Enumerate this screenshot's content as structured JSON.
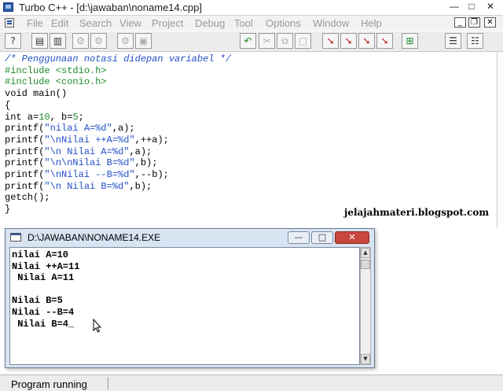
{
  "window": {
    "title": "Turbo C++ - [d:\\jawaban\\noname14.cpp]",
    "icon": "turbo-cpp-app-icon",
    "controls": {
      "minimize": "—",
      "maximize": "□",
      "close": "✕"
    }
  },
  "menu": {
    "items": [
      "File",
      "Edit",
      "Search",
      "View",
      "Project",
      "Debug",
      "Tool",
      "Options",
      "Window",
      "Help"
    ],
    "mdi_controls": {
      "minimize": "_",
      "restore": "❐",
      "close": "✕"
    },
    "item_color": "#9a9a9a"
  },
  "toolbar": {
    "buttons": [
      {
        "icon": "help-context-icon",
        "glyph": "?"
      },
      {
        "icon": "open-file-icon",
        "glyph": "▤"
      },
      {
        "icon": "save-file-icon",
        "glyph": "▥"
      },
      {
        "icon": "compile-icon",
        "glyph": "⚙"
      },
      {
        "icon": "make-icon",
        "glyph": "⚙"
      },
      {
        "icon": "build-icon",
        "glyph": "⚙"
      },
      {
        "icon": "run-icon",
        "glyph": "▣"
      },
      {
        "icon": "undo-icon",
        "glyph": "↶"
      },
      {
        "icon": "cut-icon",
        "glyph": "✂"
      },
      {
        "icon": "copy-icon",
        "glyph": "⧉"
      },
      {
        "icon": "paste-icon",
        "glyph": "▢"
      },
      {
        "icon": "search-icon",
        "glyph": "➘"
      },
      {
        "icon": "replace-icon",
        "glyph": "➘"
      },
      {
        "icon": "search-again-icon",
        "glyph": "➘"
      },
      {
        "icon": "find-in-files-icon",
        "glyph": "➘"
      },
      {
        "icon": "browse-icon",
        "glyph": "⊞"
      },
      {
        "icon": "project-icon",
        "glyph": "☰"
      },
      {
        "icon": "message-icon",
        "glyph": "☷"
      }
    ]
  },
  "editor": {
    "filename": "noname14.cpp",
    "lines": [
      [
        {
          "t": "/* Penggunaan notasi didepan variabel */",
          "c": "c-comment"
        }
      ],
      [
        {
          "t": "#include <stdio.h>",
          "c": "c-pp"
        }
      ],
      [
        {
          "t": "#include <conio.h>",
          "c": "c-pp"
        }
      ],
      [
        {
          "t": "void main()",
          "c": ""
        }
      ],
      [
        {
          "t": "{",
          "c": ""
        }
      ],
      [
        {
          "t": "int a=",
          "c": ""
        },
        {
          "t": "10",
          "c": "c-num"
        },
        {
          "t": ", b=",
          "c": ""
        },
        {
          "t": "5",
          "c": "c-num"
        },
        {
          "t": ";",
          "c": ""
        }
      ],
      [
        {
          "t": "printf(",
          "c": ""
        },
        {
          "t": "\"nilai A=%d\"",
          "c": "c-str"
        },
        {
          "t": ",a);",
          "c": ""
        }
      ],
      [
        {
          "t": "printf(",
          "c": ""
        },
        {
          "t": "\"\\nNilai ++A=%d\"",
          "c": "c-str"
        },
        {
          "t": ",++a);",
          "c": ""
        }
      ],
      [
        {
          "t": "printf(",
          "c": ""
        },
        {
          "t": "\"\\n Nilai A=%d\"",
          "c": "c-str"
        },
        {
          "t": ",a);",
          "c": ""
        }
      ],
      [
        {
          "t": "printf(",
          "c": ""
        },
        {
          "t": "\"\\n\\nNilai B=%d\"",
          "c": "c-str"
        },
        {
          "t": ",b);",
          "c": ""
        }
      ],
      [
        {
          "t": "printf(",
          "c": ""
        },
        {
          "t": "\"\\nNilai --B=%d\"",
          "c": "c-str"
        },
        {
          "t": ",--b);",
          "c": ""
        }
      ],
      [
        {
          "t": "printf(",
          "c": ""
        },
        {
          "t": "\"\\n Nilai B=%d\"",
          "c": "c-str"
        },
        {
          "t": ",b);",
          "c": ""
        }
      ],
      [
        {
          "t": "getch();",
          "c": ""
        }
      ],
      [
        {
          "t": "}",
          "c": ""
        }
      ]
    ],
    "watermark": "jelajahmateri.blogspot.com"
  },
  "console": {
    "title": "D:\\JAWABAN\\NONAME14.EXE",
    "controls": {
      "minimize": "—",
      "maximize": "□",
      "close": "✕"
    },
    "output": [
      "nilai A=10",
      "Nilai ++A=11",
      " Nilai A=11",
      "",
      "Nilai B=5",
      "Nilai --B=4",
      " Nilai B=4_"
    ],
    "scroll": {
      "up": "▲",
      "down": "▼"
    }
  },
  "status": {
    "text": "Program running"
  }
}
